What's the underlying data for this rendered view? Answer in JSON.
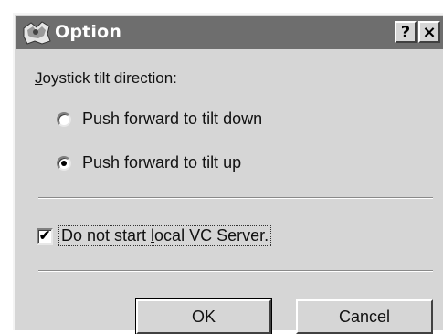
{
  "window": {
    "title": "Option",
    "help_button": "?",
    "close_button": "×",
    "app_icon": "vc-app-icon"
  },
  "joystick_group": {
    "label_mnemonic": "J",
    "label_rest": "oystick tilt direction:",
    "options": [
      {
        "label": "Push forward to tilt down",
        "checked": false
      },
      {
        "label": "Push forward to tilt up",
        "checked": true
      }
    ]
  },
  "vc_server": {
    "checkbox_checked": true,
    "checkmark": "✔",
    "label_before": "Do not start ",
    "label_mnemonic": "l",
    "label_after": "ocal VC Server."
  },
  "buttons": {
    "ok": "OK",
    "cancel": "Cancel"
  },
  "colors": {
    "titlebar": "#6e6e6e",
    "face": "#d6d6d6"
  }
}
